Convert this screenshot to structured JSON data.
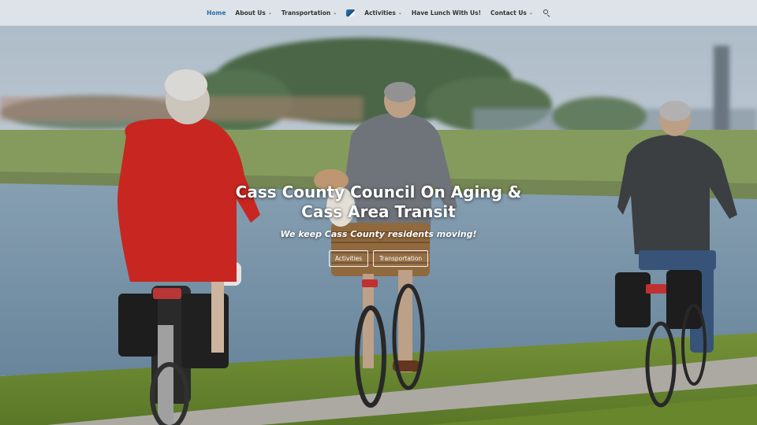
{
  "nav": {
    "items": [
      {
        "label": "Home",
        "active": true,
        "has_dropdown": false
      },
      {
        "label": "About Us",
        "active": false,
        "has_dropdown": true
      },
      {
        "label": "Transportation",
        "active": false,
        "has_dropdown": true
      },
      {
        "label": "Activities",
        "active": false,
        "has_dropdown": true
      },
      {
        "label": "Have Lunch With Us!",
        "active": false,
        "has_dropdown": false
      },
      {
        "label": "Contact Us",
        "active": false,
        "has_dropdown": true
      }
    ],
    "chevron": "⌄",
    "logo_icon": "site-logo-icon",
    "search_icon": "search-icon",
    "active_color": "#2c6fa5"
  },
  "hero": {
    "title": "Cass County Council On Aging & Cass Area Transit",
    "subtitle": "We keep Cass County residents moving!",
    "buttons": [
      {
        "label": "Activities"
      },
      {
        "label": "Transportation"
      }
    ],
    "image_subject": "three seniors riding bicycles along a lakeside path"
  }
}
